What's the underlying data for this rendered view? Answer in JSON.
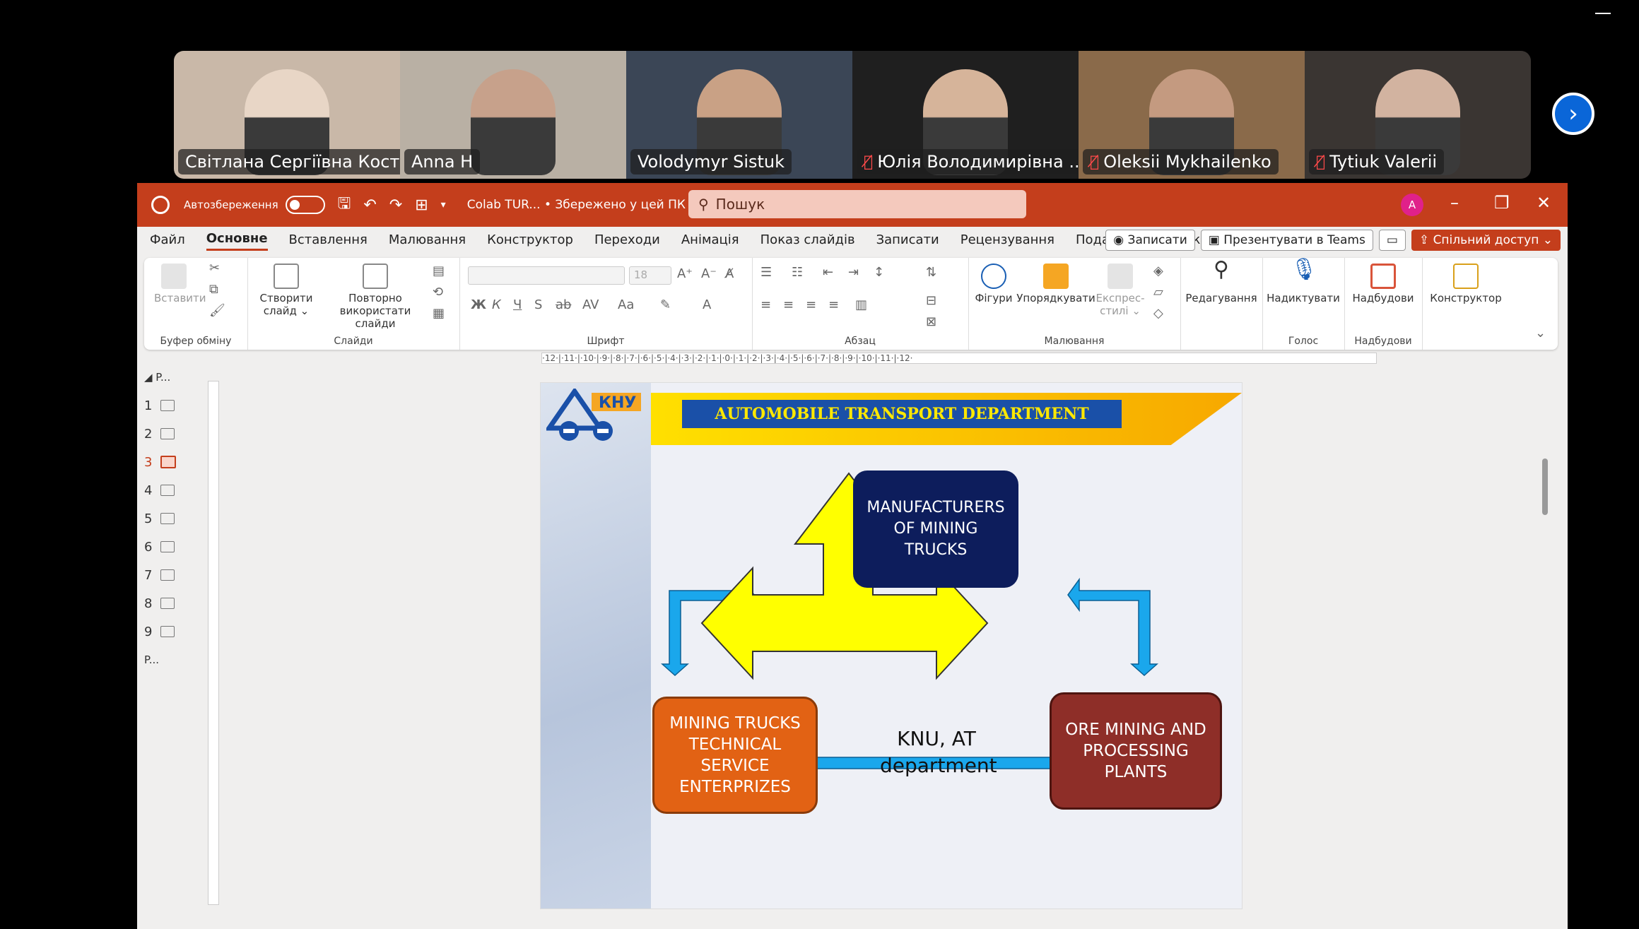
{
  "participants": [
    {
      "name": "Світлана Сергіївна Костюк",
      "muted": false,
      "bg": "#c9b8a8",
      "skin": "#e8d6c6"
    },
    {
      "name": "Anna H",
      "muted": false,
      "bg": "#b9b0a4",
      "skin": "#c7a18b"
    },
    {
      "name": "Volodymyr Sistuk",
      "muted": false,
      "active": true,
      "bg": "#3b4656",
      "skin": "#c9a185"
    },
    {
      "name": "Юлія Володимирівна ...",
      "muted": true,
      "bg": "#1f1f1f",
      "skin": "#d6b49a"
    },
    {
      "name": "Oleksii Mykhailenko",
      "muted": true,
      "bg": "#8a6a4a",
      "skin": "#c49a80"
    },
    {
      "name": "Tytiuk Valerii",
      "muted": true,
      "bg": "#3a3532",
      "skin": "#d2b3a0"
    }
  ],
  "titlebar": {
    "autosave": "Автозбереження",
    "doc_title": "Colab TUR...  •  Збережено у цей ПК ⌄",
    "search_placeholder": "Пошук",
    "avatar": "A"
  },
  "menu": [
    "Файл",
    "Основне",
    "Вставлення",
    "Малювання",
    "Конструктор",
    "Переходи",
    "Анімація",
    "Показ слайдів",
    "Записати",
    "Рецензування",
    "Подання",
    "Довідка"
  ],
  "menu_selected": 1,
  "menu_right": {
    "record": "Записати",
    "teams": "Презентувати в Teams",
    "share": "Спільний доступ ⌄"
  },
  "ribbon": {
    "paste": "Вставити",
    "clipboard": "Буфер обміну",
    "new_slide": "Створити слайд ⌄",
    "reuse": "Повторно використати слайди",
    "slides": "Слайди",
    "font": "Шрифт",
    "font_size": "18",
    "paragraph": "Абзац",
    "shapes": "Фігури",
    "arrange": "Упорядкувати",
    "quick_styles": "Експрес-стилі ⌄",
    "drawing": "Малювання",
    "editing": "Редагування",
    "dictate": "Надиктувати",
    "voice": "Голос",
    "addins": "Надбудови",
    "addins_group": "Надбудови",
    "designer": "Конструктор"
  },
  "thumbnails": [
    "1",
    "2",
    "3",
    "4",
    "5",
    "6",
    "7",
    "8",
    "9"
  ],
  "thumbnail_selected": 2,
  "section_labels": [
    "P...",
    "P..."
  ],
  "slide": {
    "banner": "AUTOMOBILE TRANSPORT DEPARTMENT",
    "logo_text": "КНУ",
    "manufacturers": "MANUFACTURERS OF MINING TRUCKS",
    "mining_trucks": "MINING TRUCKS TECHNICAL SERVICE ENTERPRIZES",
    "ore": "ORE MINING AND PROCESSING PLANTS",
    "center": "KNU, AT department"
  },
  "ruler": "·12·|·11·|·10·|·9·|·8·|·7·|·6·|·5·|·4·|·3·|·2·|·1·|·0·|·1·|·2·|·3·|·4·|·5·|·6·|·7·|·8·|·9·|·10·|·11·|·12·",
  "colors": {
    "ppt_red": "#c43e1c",
    "active_border": "#2bd27a",
    "arrow_blue": "#1aa7ec",
    "arrow_yellow": "#ffff00"
  }
}
